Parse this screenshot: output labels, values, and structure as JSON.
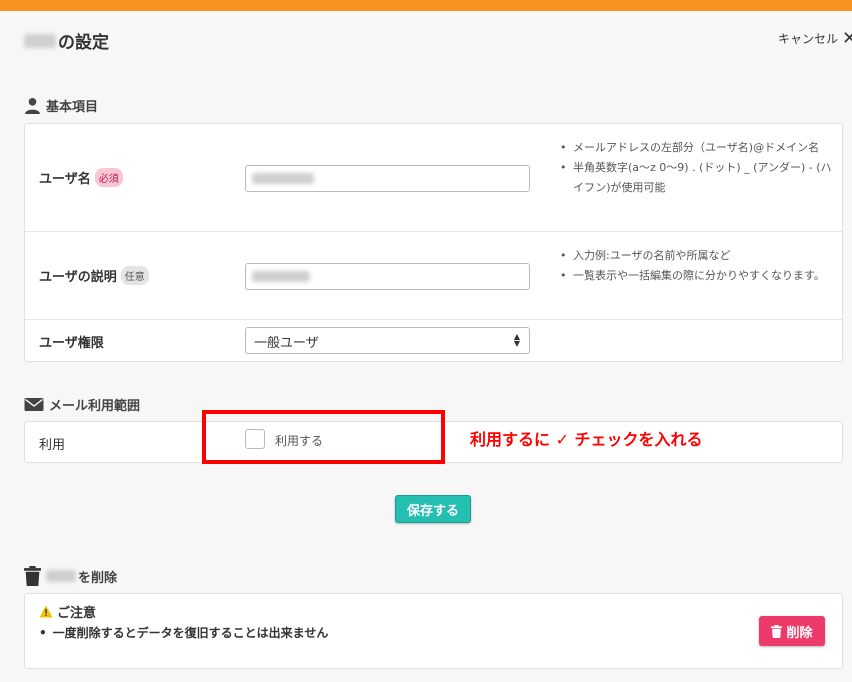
{
  "header": {
    "title_suffix": "の設定",
    "cancel_label": "キャンセル",
    "cancel_icon": "close-icon",
    "accent_color": "#f7931e"
  },
  "basic_section": {
    "heading": "基本項目",
    "icon": "user-icon",
    "rows": {
      "username": {
        "label": "ユーザ名",
        "badge": "必須",
        "hints": [
          "メールアドレスの左部分（ユーザ名)@ドメイン名",
          "半角英数字(a〜z 0〜9) . (ドット) _ (アンダー) - (ハイフン)が使用可能"
        ]
      },
      "description": {
        "label": "ユーザの説明",
        "badge": "任意",
        "hints": [
          "入力例:ユーザの名前や所属など",
          "一覧表示や一括編集の際に分かりやすくなります。"
        ]
      },
      "permission": {
        "label": "ユーザ権限",
        "selected": "一般ユーザ"
      }
    }
  },
  "mail_section": {
    "heading": "メール利用範囲",
    "icon": "envelope-icon",
    "row_label": "利用",
    "checkbox_label": "利用する",
    "checked": false
  },
  "annotation": {
    "text": "利用するに ✓ チェックを入れる",
    "color": "#ff0000"
  },
  "save_button": {
    "label": "保存する",
    "color": "#24bfb1"
  },
  "delete_section": {
    "heading_suffix": "を削除",
    "icon": "trash-icon",
    "caution_title": "ご注意",
    "caution_icon": "warning-icon",
    "caution_text": "一度削除するとデータを復旧することは出来ません",
    "delete_label": "削除",
    "delete_color": "#ec3b6a"
  }
}
